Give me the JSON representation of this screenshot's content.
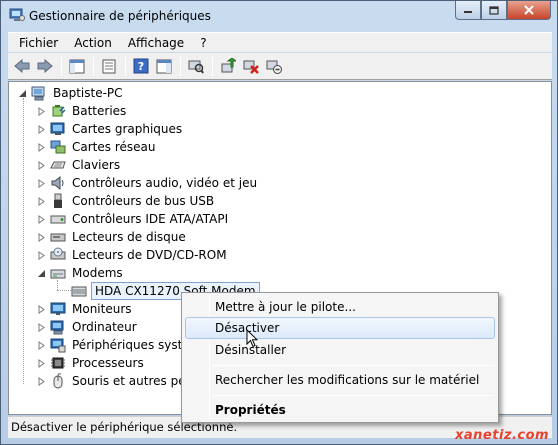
{
  "window": {
    "title": "Gestionnaire de périphériques"
  },
  "menubar": {
    "items": [
      "Fichier",
      "Action",
      "Affichage",
      "?"
    ]
  },
  "toolbar": {
    "buttons": [
      "back-icon",
      "forward-icon",
      "show-hide-tree-icon",
      "properties-icon",
      "help-icon",
      "action-pane-icon",
      "scan-hardware-icon",
      "update-driver-icon",
      "uninstall-icon",
      "disable-icon"
    ]
  },
  "tree": {
    "root": "Baptiste-PC",
    "categories": [
      {
        "label": "Batteries",
        "icon": "battery-icon"
      },
      {
        "label": "Cartes graphiques",
        "icon": "display-adapter-icon"
      },
      {
        "label": "Cartes réseau",
        "icon": "network-adapter-icon"
      },
      {
        "label": "Claviers",
        "icon": "keyboard-icon"
      },
      {
        "label": "Contrôleurs audio, vidéo et jeu",
        "icon": "audio-icon"
      },
      {
        "label": "Contrôleurs de bus USB",
        "icon": "usb-icon"
      },
      {
        "label": "Contrôleurs IDE ATA/ATAPI",
        "icon": "ide-controller-icon"
      },
      {
        "label": "Lecteurs de disque",
        "icon": "disk-drive-icon"
      },
      {
        "label": "Lecteurs de DVD/CD-ROM",
        "icon": "dvd-drive-icon"
      },
      {
        "label": "Modems",
        "icon": "modem-icon"
      },
      {
        "label": "Moniteurs",
        "icon": "monitor-icon"
      },
      {
        "label": "Ordinateur",
        "icon": "computer-icon"
      },
      {
        "label": "Périphériques systèm",
        "icon": "system-device-icon"
      },
      {
        "label": "Processeurs",
        "icon": "processor-icon"
      },
      {
        "label": "Souris et autres périp",
        "icon": "mouse-icon"
      }
    ],
    "selected_child": "HDA CX11270 Soft Modem"
  },
  "context_menu": {
    "items": [
      {
        "label": "Mettre à jour le pilote..."
      },
      {
        "label": "Désactiver"
      },
      {
        "label": "Désinstaller"
      },
      {
        "label": "Rechercher les modifications sur le matériel"
      },
      {
        "label": "Propriétés"
      }
    ]
  },
  "statusbar": {
    "text": "Désactiver le périphérique sélectionné."
  },
  "watermark": "xanetiz.com",
  "colors": {
    "selection_border": "#7da2ce",
    "menu_hover": "#dbe9f9",
    "watermark": "#e8412c"
  }
}
